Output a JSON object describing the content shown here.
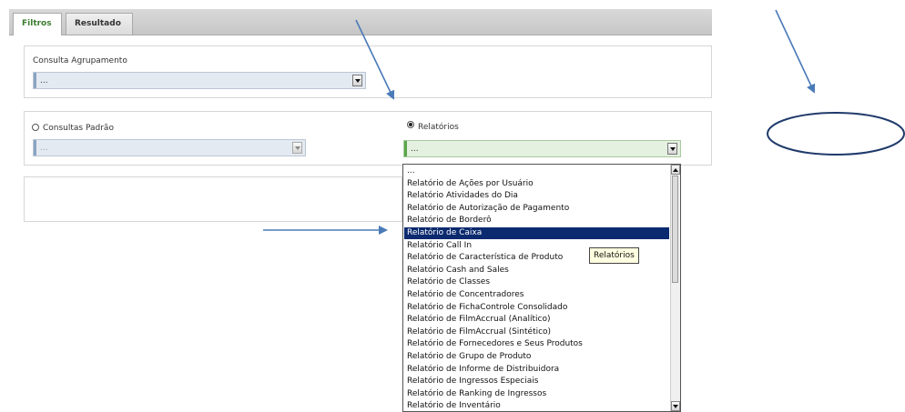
{
  "tabs": [
    {
      "label": "Filtros",
      "active": true
    },
    {
      "label": "Resultado",
      "active": false
    }
  ],
  "grouping": {
    "label": "Consulta Agrupamento",
    "value": "..."
  },
  "standard_queries": {
    "label": "Consultas Padrão",
    "value": "...",
    "selected": false
  },
  "reports": {
    "label": "Relatórios",
    "value": "...",
    "selected": true,
    "options": [
      "...",
      "Relatório de Ações por Usuário",
      "Relatório Atividades do Dia",
      "Relatório de Autorização de Pagamento",
      "Relatório de Borderô",
      "Relatório de Caixa",
      "Relatório Call In",
      "Relatório de Característica de Produto",
      "Relatório Cash and Sales",
      "Relatório de Classes",
      "Relatório de Concentradores",
      "Relatório de FichaControle Consolidado",
      "Relatório de FilmAccrual (Analítico)",
      "Relatório de FilmAccrual (Sintético)",
      "Relatório de Fornecedores e Seus Produtos",
      "Relatório de Grupo de Produto",
      "Relatório de Informe de Distribuidora",
      "Relatório de Ingressos Especiais",
      "Relatório de Ranking de Ingressos",
      "Relatório de Inventário"
    ],
    "highlighted_index": 5
  },
  "tooltip": "Relatórios",
  "colors": {
    "active_tab_text": "#3a7d2e",
    "highlight": "#0b2a6f",
    "annotation_blue": "#4a7ab8",
    "annotation_oval": "#1f3a6b"
  }
}
